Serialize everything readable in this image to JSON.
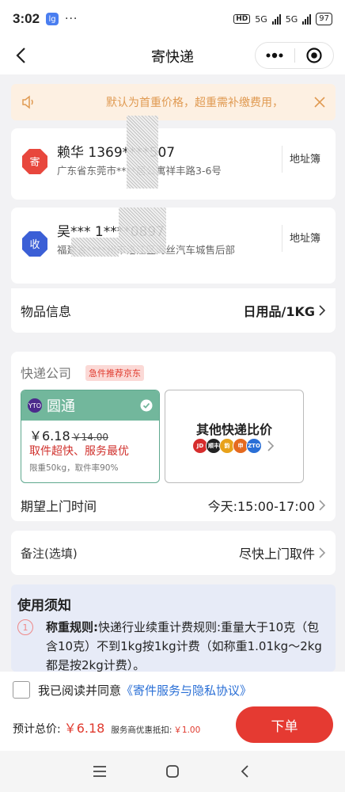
{
  "status_bar": {
    "time": "3:02",
    "app_badge": "lg",
    "dots": "···",
    "hd": "HD",
    "net1": "5G",
    "net2": "5G",
    "battery": "97"
  },
  "nav": {
    "title": "寄快递"
  },
  "notice": {
    "text": "默认为首重价格，超重需补缴费用，"
  },
  "sender": {
    "badge": "寄",
    "name": "赖华  1369****507",
    "address": "广东省东莞市****居公寓祥丰路3-6号",
    "address_book": "地址簿",
    "badge_color": "#e8473d"
  },
  "receiver": {
    "badge": "收",
    "name": "吴***  1****0897",
    "address": "福建省****州市洛江区海丝汽车城售后部",
    "address_book": "地址簿",
    "badge_color": "#3b5fd6"
  },
  "goods": {
    "label": "物品信息",
    "value": "日用品/1KG"
  },
  "courier": {
    "label": "快递公司",
    "tag": "急件推荐京东",
    "selected": {
      "name": "圆通",
      "logo_text": "YTO",
      "price": "￥6.18",
      "old_price": "￥14.00",
      "slogan": "取件超快、服务最优",
      "detail": "限重50kg，取件率90%"
    },
    "compare": {
      "title": "其他快递比价",
      "logos": [
        {
          "text": "JD",
          "color": "#d62d2d"
        },
        {
          "text": "顺丰",
          "color": "#222222"
        },
        {
          "text": "韵",
          "color": "#e8a21a"
        },
        {
          "text": "申",
          "color": "#e56a1f"
        },
        {
          "text": "ZTO",
          "color": "#2a6fd6"
        }
      ]
    },
    "time_label": "期望上门时间",
    "time_value": "今天:15:00-17:00"
  },
  "remark": {
    "label": "备注(选填)",
    "value": "尽快上门取件"
  },
  "usage_notes": {
    "heading": "使用须知",
    "number": "1",
    "rule_title": "称重规则:",
    "rule_text": "快递行业续重计费规则:重量大于10克（包含10克）不到1kg按1kg计费（如称重1.01kg～2kg都是按2kg计费）。"
  },
  "footer": {
    "agree_text": "我已阅读并同意",
    "agree_link": "《寄件服务与隐私协议》",
    "total_label": "预计总价:",
    "total_amount": "￥6.18",
    "discount_label": "服务商优惠抵扣:",
    "discount_amount": "￥1.00",
    "submit_label": "下单"
  }
}
